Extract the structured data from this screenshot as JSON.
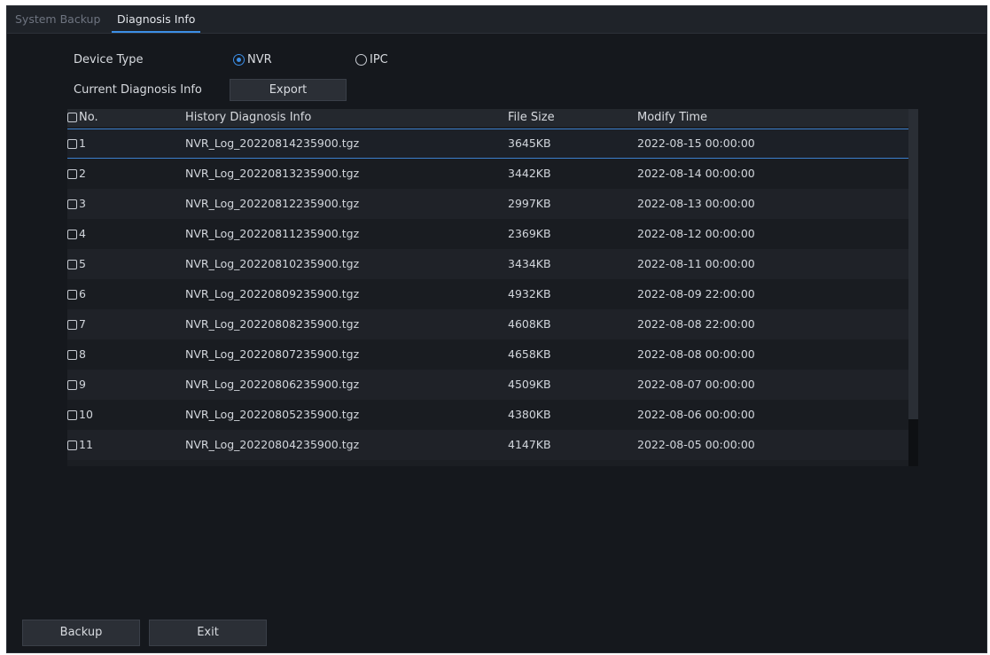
{
  "tabs": [
    {
      "label": "System Backup",
      "active": false
    },
    {
      "label": "Diagnosis Info",
      "active": true
    }
  ],
  "device_type": {
    "label": "Device Type",
    "options": [
      {
        "label": "NVR",
        "selected": true
      },
      {
        "label": "IPC",
        "selected": false
      }
    ]
  },
  "current_diagnosis": {
    "label": "Current Diagnosis Info",
    "export_label": "Export"
  },
  "table": {
    "columns": [
      "No.",
      "History Diagnosis Info",
      "File Size",
      "Modify Time"
    ],
    "rows": [
      {
        "no": "1",
        "name": "NVR_Log_20220814235900.tgz",
        "size": "3645KB",
        "time": "2022-08-15 00:00:00"
      },
      {
        "no": "2",
        "name": "NVR_Log_20220813235900.tgz",
        "size": "3442KB",
        "time": "2022-08-14 00:00:00"
      },
      {
        "no": "3",
        "name": "NVR_Log_20220812235900.tgz",
        "size": "2997KB",
        "time": "2022-08-13 00:00:00"
      },
      {
        "no": "4",
        "name": "NVR_Log_20220811235900.tgz",
        "size": "2369KB",
        "time": "2022-08-12 00:00:00"
      },
      {
        "no": "5",
        "name": "NVR_Log_20220810235900.tgz",
        "size": "3434KB",
        "time": "2022-08-11 00:00:00"
      },
      {
        "no": "6",
        "name": "NVR_Log_20220809235900.tgz",
        "size": "4932KB",
        "time": "2022-08-09 22:00:00"
      },
      {
        "no": "7",
        "name": "NVR_Log_20220808235900.tgz",
        "size": "4608KB",
        "time": "2022-08-08 22:00:00"
      },
      {
        "no": "8",
        "name": "NVR_Log_20220807235900.tgz",
        "size": "4658KB",
        "time": "2022-08-08 00:00:00"
      },
      {
        "no": "9",
        "name": "NVR_Log_20220806235900.tgz",
        "size": "4509KB",
        "time": "2022-08-07 00:00:00"
      },
      {
        "no": "10",
        "name": "NVR_Log_20220805235900.tgz",
        "size": "4380KB",
        "time": "2022-08-06 00:00:00"
      },
      {
        "no": "11",
        "name": "NVR_Log_20220804235900.tgz",
        "size": "4147KB",
        "time": "2022-08-05 00:00:00"
      }
    ],
    "selected_row": "1"
  },
  "footer": {
    "backup_label": "Backup",
    "exit_label": "Exit"
  },
  "colors": {
    "accent": "#3c8ee6",
    "background": "#15181d"
  }
}
